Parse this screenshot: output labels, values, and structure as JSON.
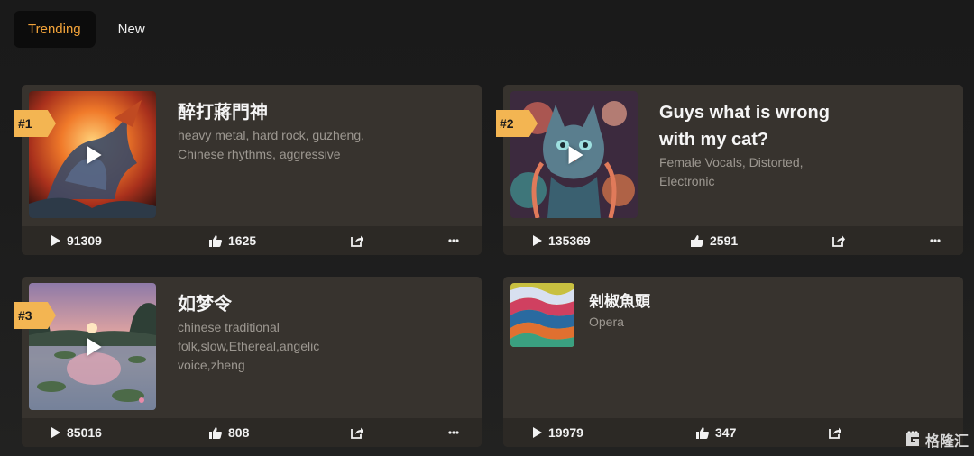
{
  "tabs": [
    {
      "label": "Trending",
      "active": true
    },
    {
      "label": "New",
      "active": false
    }
  ],
  "songs": [
    {
      "rank": "#1",
      "title": "醉打蔣門神",
      "tags_line1": "heavy metal, hard rock, guzheng,",
      "tags_line2": "Chinese rhythms, aggressive",
      "tags_line3": "",
      "plays": "91309",
      "likes": "1625"
    },
    {
      "rank": "#2",
      "title": "Guys what is wrong",
      "title_line2": "with my cat?",
      "tags_line1": "Female Vocals, Distorted,",
      "tags_line2": "Electronic",
      "plays": "135369",
      "likes": "2591"
    },
    {
      "rank": "#3",
      "title": "如梦令",
      "tags_line1": "chinese traditional",
      "tags_line2": "folk,slow,Ethereal,angelic",
      "tags_line3": "voice,zheng",
      "plays": "85016",
      "likes": "808"
    },
    {
      "rank": "",
      "title": "剁椒魚頭",
      "tags_line1": "Opera",
      "plays": "19979",
      "likes": "347"
    }
  ],
  "watermark": {
    "text": "格隆汇"
  },
  "colors": {
    "accent": "#f2a33a",
    "rank_badge": "#f3b552",
    "card": "#37332e",
    "footer": "#2c2925"
  }
}
